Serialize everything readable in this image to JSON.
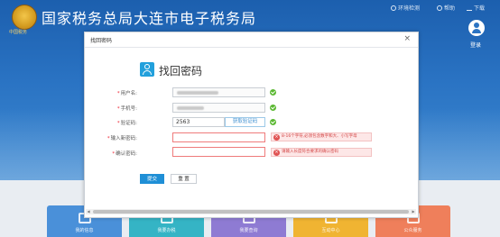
{
  "header": {
    "emblem_text": "中国税务",
    "site_title": "国家税务总局大连市电子税务局",
    "links": [
      {
        "label": "环境检测"
      },
      {
        "label": "帮助"
      },
      {
        "label": "下载"
      }
    ],
    "login_label": "登录"
  },
  "tiles": [
    {
      "label": "我的信息",
      "color": "#4a90d9"
    },
    {
      "label": "我要办税",
      "color": "#35b4c5"
    },
    {
      "label": "我要查询",
      "color": "#8e7bd3"
    },
    {
      "label": "互动中心",
      "color": "#f0b432"
    },
    {
      "label": "公众服务",
      "color": "#ef7f5b"
    }
  ],
  "dialog": {
    "title": "找回密码",
    "heading": "找回密码",
    "form": {
      "username_label": "用户名:",
      "phone_label": "手机号:",
      "captcha_label": "验证码:",
      "captcha_value": "2563",
      "get_code_label": "获取验证码",
      "new_password_label": "输入新密码:",
      "confirm_password_label": "确认密码:",
      "new_password_error": "8-16个字符,必须包含数字和大、小写字母",
      "confirm_password_error": "请输入长度符合要求的确认密码"
    },
    "submit_label": "提交",
    "reset_label": "重 置"
  }
}
